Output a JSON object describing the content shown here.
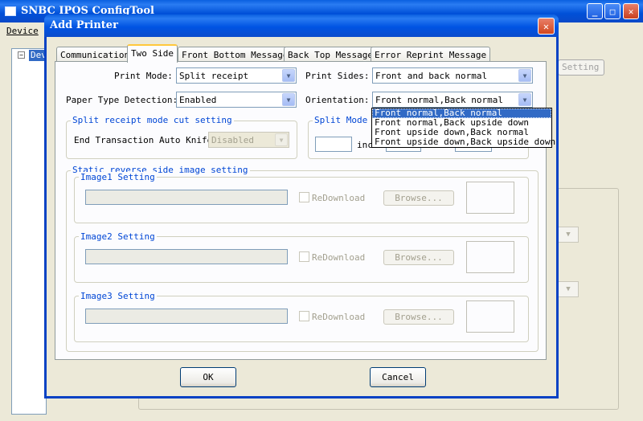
{
  "main_window": {
    "title": "SNBC IPOS ConfigTool",
    "menu": [
      "Device"
    ],
    "tree_node": "Device",
    "hidden_button": "Setting"
  },
  "dialog": {
    "title": "Add Printer",
    "tabs": [
      "Communication",
      "Two Side",
      "Front Bottom Message",
      "Back Top Message",
      "Error Reprint Message"
    ],
    "active_tab": "Two Side",
    "print_mode": {
      "label": "Print Mode:",
      "value": "Split receipt"
    },
    "print_sides": {
      "label": "Print Sides:",
      "value": "Front and back normal"
    },
    "paper_type": {
      "label": "Paper Type Detection:",
      "value": "Enabled"
    },
    "orientation": {
      "label": "Orientation:",
      "value": "Front normal,Back normal",
      "options": [
        "Front normal,Back normal",
        "Front normal,Back upside down",
        "Front upside down,Back normal",
        "Front upside down,Back upside down"
      ],
      "selected_index": 0
    },
    "split_cut": {
      "title": "Split receipt mode cut setting",
      "knife_label": "End Transaction Auto Knife:",
      "knife_value": "Disabled"
    },
    "split_mode": {
      "title": "Split Mode M",
      "unit": "inc"
    },
    "static_reverse": {
      "title": "Static reverse side image setting",
      "images": [
        {
          "title": "Image1 Setting",
          "redownload": "ReDownload",
          "browse": "Browse..."
        },
        {
          "title": "Image2 Setting",
          "redownload": "ReDownload",
          "browse": "Browse..."
        },
        {
          "title": "Image3 Setting",
          "redownload": "ReDownload",
          "browse": "Browse..."
        }
      ]
    },
    "ok_label": "OK",
    "cancel_label": "Cancel"
  }
}
